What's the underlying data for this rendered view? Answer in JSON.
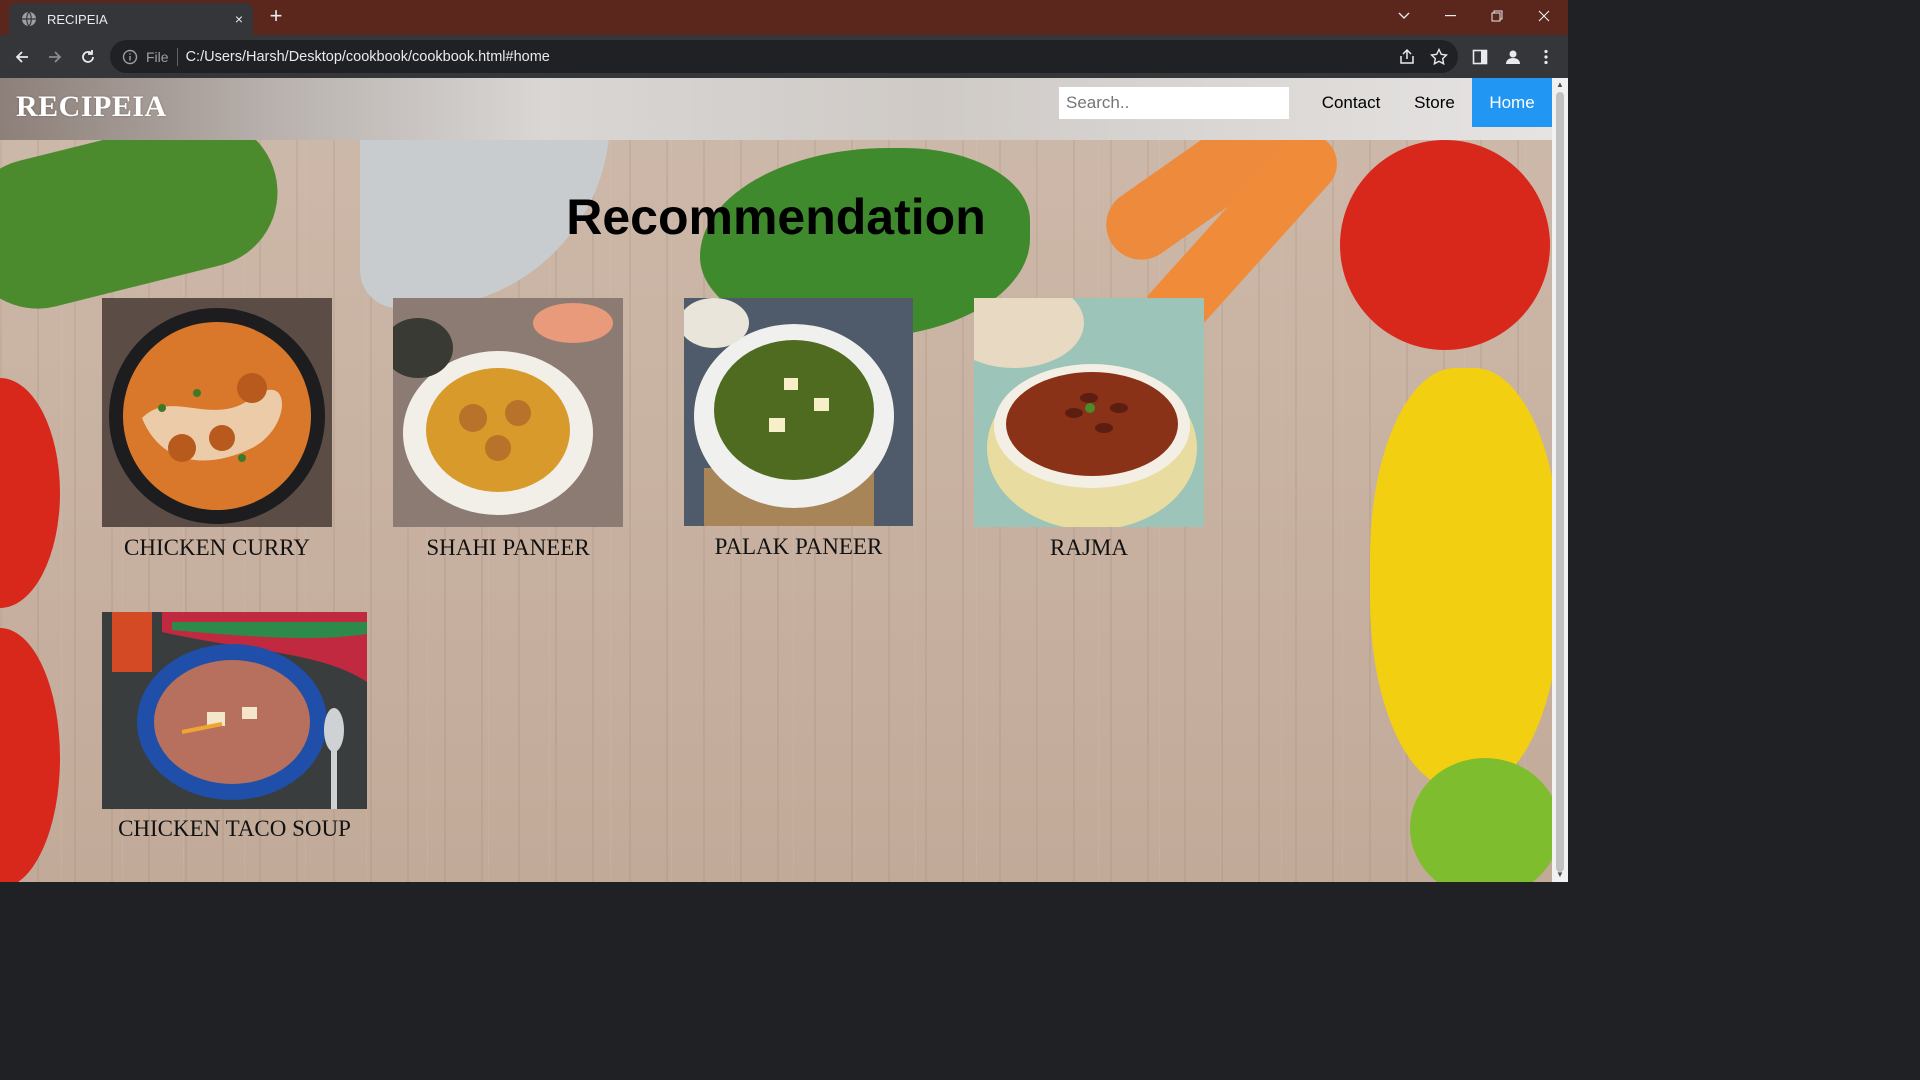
{
  "browser": {
    "tab_title": "RECIPEIA",
    "new_tab": "+",
    "tab_close": "×",
    "omnibox_scheme": "File",
    "url": "C:/Users/Harsh/Desktop/cookbook/cookbook.html#home"
  },
  "site": {
    "brand": "RECIPEIA",
    "search_placeholder": "Search..",
    "nav": [
      {
        "label": "Contact",
        "active": false
      },
      {
        "label": "Store",
        "active": false
      },
      {
        "label": "Home",
        "active": true
      }
    ],
    "heading": "Recommendation",
    "recipes": [
      {
        "name": "CHICKEN CURRY",
        "image": "chicken-curry-photo"
      },
      {
        "name": "SHAHI PANEER",
        "image": "shahi-paneer-photo"
      },
      {
        "name": "PALAK PANEER",
        "image": "palak-paneer-photo"
      },
      {
        "name": "RAJMA",
        "image": "rajma-photo"
      },
      {
        "name": "CHICKEN TACO SOUP",
        "image": "chicken-taco-soup-photo"
      }
    ]
  },
  "colors": {
    "tabbar": "#5b271d",
    "toolbar": "#35363a",
    "nav_active": "#2196f3",
    "wood": "#c9b3a3"
  }
}
